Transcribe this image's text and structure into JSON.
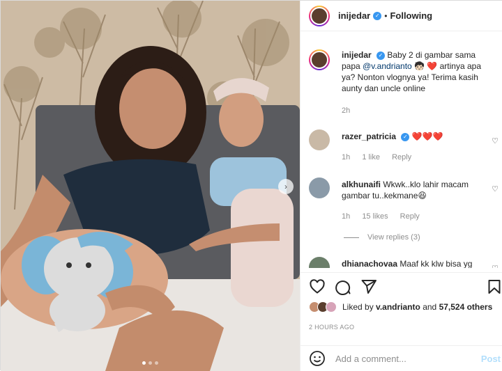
{
  "header": {
    "username": "inijedar",
    "separator": "•",
    "follow_status": "Following"
  },
  "caption": {
    "username": "inijedar",
    "text_before_mention": "Baby 2 di gambar sama papa",
    "mention": "@v.andrianto",
    "text_after_mention": "🧒🏻 ❤️ artinya apa ya? Nonton vlognya ya! Terima kasih aunty dan uncle online",
    "time": "2h"
  },
  "comments": [
    {
      "username": "razer_patricia",
      "text": "❤️❤️❤️",
      "time": "1h",
      "likes": "1 like",
      "reply": "Reply"
    },
    {
      "username": "alkhunaifi",
      "text": "Wkwk..klo lahir macam gambar tu..kekmane😆",
      "time": "1h",
      "likes": "15 likes",
      "reply": "Reply",
      "view_replies": "View replies (3)"
    },
    {
      "username": "dhianachovaa",
      "text": "Maaf kk klw bisa yg"
    }
  ],
  "likes": {
    "prefix": "Liked by",
    "user": "v.andrianto",
    "connector": "and",
    "others": "57,524 others"
  },
  "timestamp": "2 HOURS AGO",
  "comment_box": {
    "placeholder": "Add a comment...",
    "post_label": "Post"
  },
  "carousel": {
    "slides": 3,
    "active": 1
  },
  "icons": [
    "heart-icon",
    "comment-icon",
    "share-icon",
    "save-icon",
    "emoji-icon",
    "chevron-right-icon",
    "verified-icon"
  ],
  "colors": {
    "verified": "#3897f0",
    "mention": "#00376b",
    "heart": "#ed4956",
    "post_disabled": "#b2dffc"
  }
}
